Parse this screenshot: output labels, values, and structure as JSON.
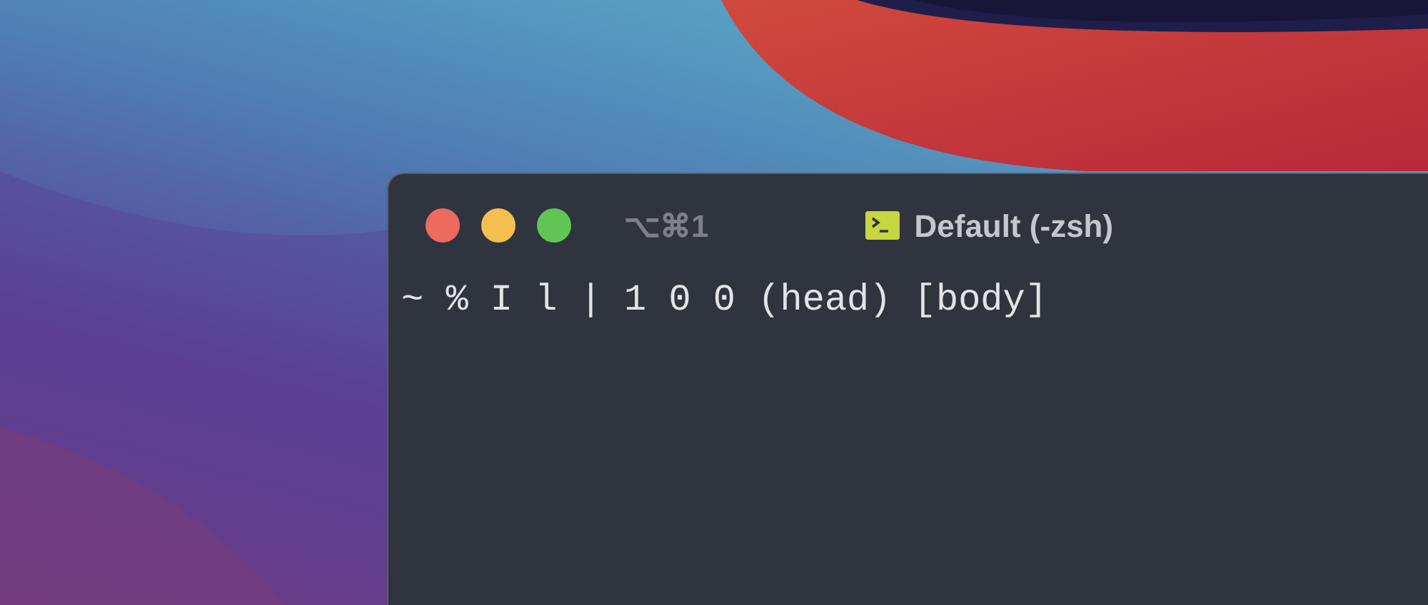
{
  "window": {
    "shortcut": "⌥⌘1",
    "title": "Default (-zsh)",
    "traffic_lights": [
      {
        "color": "#ed6a5e"
      },
      {
        "color": "#f5bf4f"
      },
      {
        "color": "#61c554"
      }
    ]
  },
  "terminal": {
    "lines": [
      "~ % I l | 1 0 0 (head) [body]"
    ]
  }
}
